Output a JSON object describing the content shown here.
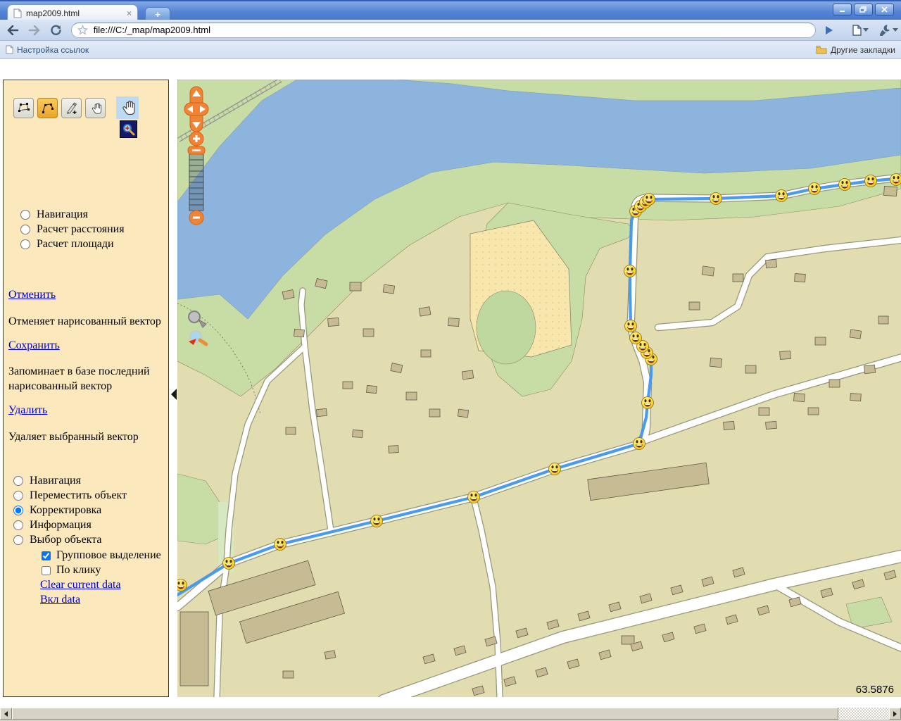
{
  "browser": {
    "tab_title": "map2009.html",
    "url": "file:///C:/_map/map2009.html",
    "new_tab_label": "+",
    "bookmarks_bar": {
      "configure_links": "Настройка ссылок",
      "other_bookmarks": "Другие закладки"
    }
  },
  "icons": {
    "sidebar_tools": [
      "select-area",
      "draw-polygon",
      "draw-vector",
      "pan-hand",
      "pan-cursor",
      "zoom-in"
    ],
    "map_controls": [
      "pan-compass",
      "zoom-in",
      "zoom-slider",
      "zoom-out",
      "magnifier-inactive",
      "magnifier-active"
    ]
  },
  "sidebar": {
    "measure_modes": {
      "items": [
        {
          "label": "Навигация",
          "checked": false
        },
        {
          "label": "Расчет расстояния",
          "checked": false
        },
        {
          "label": "Расчет площади",
          "checked": false
        }
      ]
    },
    "actions": {
      "cancel": {
        "label": "Отменить",
        "description": "Отменяет нарисованный вектор"
      },
      "save": {
        "label": "Сохранить",
        "description": "Запоминает в базе последний нарисованный вектор"
      },
      "delete": {
        "label": "Удалить",
        "description": "Удаляет выбранный вектор"
      }
    },
    "edit_modes": {
      "items": [
        {
          "label": "Навигация",
          "checked": false
        },
        {
          "label": "Переместить объект",
          "checked": false
        },
        {
          "label": "Корректировка",
          "checked": true
        },
        {
          "label": "Информация",
          "checked": false
        },
        {
          "label": "Выбор объекта",
          "checked": false
        }
      ]
    },
    "options": {
      "items": [
        {
          "label": "Групповое выделение",
          "checked": true
        },
        {
          "label": "По клику",
          "checked": false
        }
      ]
    },
    "links": {
      "clear": "Clear current data",
      "enable": "Вкл data"
    }
  },
  "map": {
    "coordinate_readout": "63.5876",
    "route_color": "#3e96f0",
    "water_color": "#8cb4dc",
    "land_color": "#e1ddb1",
    "green_color": "#c8dca6",
    "sidebar_color": "#fbe9bd"
  }
}
